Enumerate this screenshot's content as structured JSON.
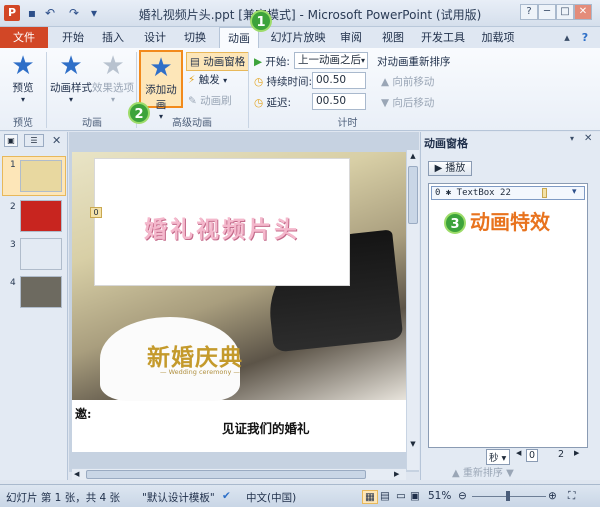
{
  "title_bar": {
    "quick_access": [
      "save-icon",
      "undo-icon",
      "redo-icon",
      "customize-icon"
    ],
    "title": "婚礼视频片头.ppt [兼容模式] - Microsoft PowerPoint (试用版)",
    "window_controls": [
      "─",
      "□",
      "✕"
    ]
  },
  "tabs": [
    {
      "label": "文件"
    },
    {
      "label": "开始"
    },
    {
      "label": "插入"
    },
    {
      "label": "设计"
    },
    {
      "label": "切换"
    },
    {
      "label": "动画",
      "selected": true
    },
    {
      "label": "幻灯片放映"
    },
    {
      "label": "审阅"
    },
    {
      "label": "视图"
    },
    {
      "label": "开发工具"
    },
    {
      "label": "加载项"
    }
  ],
  "ribbon": {
    "preview_group": {
      "button": "预览",
      "label": "预览"
    },
    "animation_group": {
      "style_button": "动画样式",
      "effect_button": "效果选项",
      "label": "动画"
    },
    "advanced_group": {
      "add_animation": "添加动画",
      "anim_pane": "动画窗格",
      "trigger": "触发",
      "anim_painter": "动画刷",
      "label": "高级动画"
    },
    "timing_group": {
      "start_label": "开始:",
      "start_value": "上一动画之后",
      "duration_label": "持续时间:",
      "duration_value": "00.50",
      "delay_label": "延迟:",
      "delay_value": "00.50",
      "reorder_title": "对动画重新排序",
      "move_earlier": "向前移动",
      "move_later": "向后移动",
      "label": "计时"
    }
  },
  "badges": {
    "one": "1",
    "two": "2",
    "three": "3"
  },
  "slides_panel": {
    "numbers": [
      "1",
      "2",
      "3",
      "4"
    ],
    "thumb_colors": [
      "#e8d8a0",
      "#c8251f",
      "#e3eaf3",
      "#6d6a60"
    ]
  },
  "slide": {
    "title": "婚礼视频片头",
    "anim_tag": "0",
    "logo_text": "新婚庆典",
    "logo_sub": "— Wedding ceremony —",
    "invite_label": "邀:",
    "invite_text": "见证我们的婚礼"
  },
  "anim_pane": {
    "title": "动画窗格",
    "play_button": "▶ 播放",
    "item": "0 ✱ TextBox 22",
    "annotation": "动画特效",
    "seconds": "秒 ▾",
    "zoom_from": "0",
    "zoom_to": "2",
    "reorder": "重新排序"
  },
  "status": {
    "slide_info": "幻灯片 第 1 张，共 4 张",
    "theme": "\"默认设计模板\"",
    "language": "中文(中国)",
    "zoom": "51%"
  }
}
